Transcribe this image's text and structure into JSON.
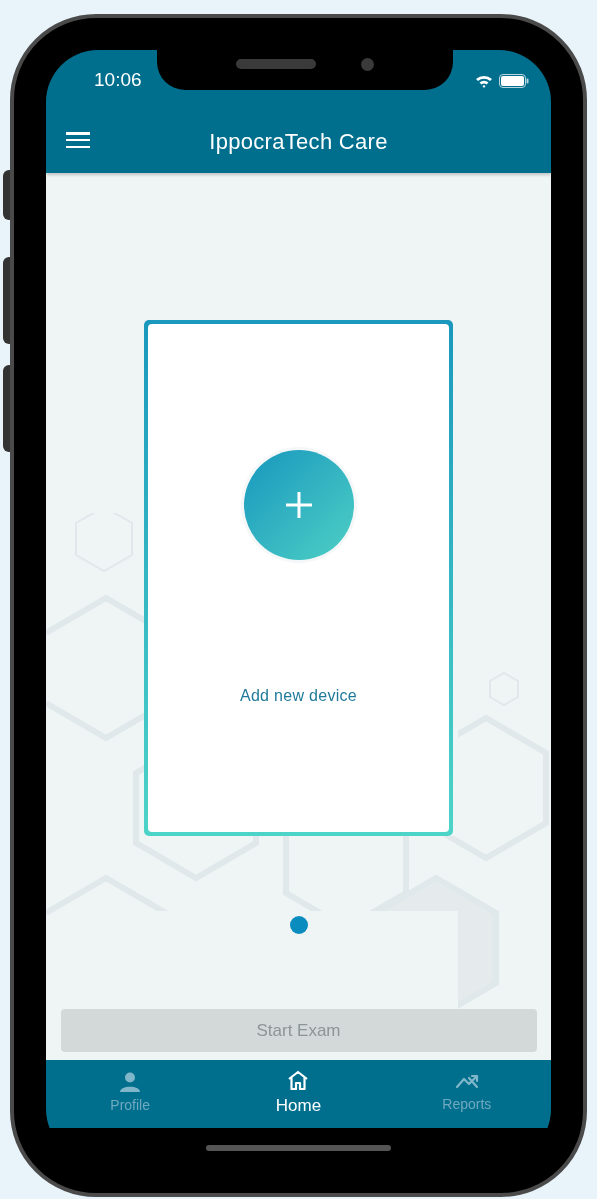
{
  "status_bar": {
    "time": "10:06"
  },
  "header": {
    "title": "IppocraTech Care"
  },
  "device_card": {
    "label": "Add new device"
  },
  "pager": [
    {
      "selected": true
    }
  ],
  "start_button": {
    "label": "Start Exam",
    "disabled": true
  },
  "tabs": [
    {
      "kind": "profile",
      "label": "Profile",
      "selected": false
    },
    {
      "kind": "home",
      "label": "Home",
      "selected": true
    },
    {
      "kind": "reports",
      "label": "Reports",
      "selected": false
    }
  ]
}
